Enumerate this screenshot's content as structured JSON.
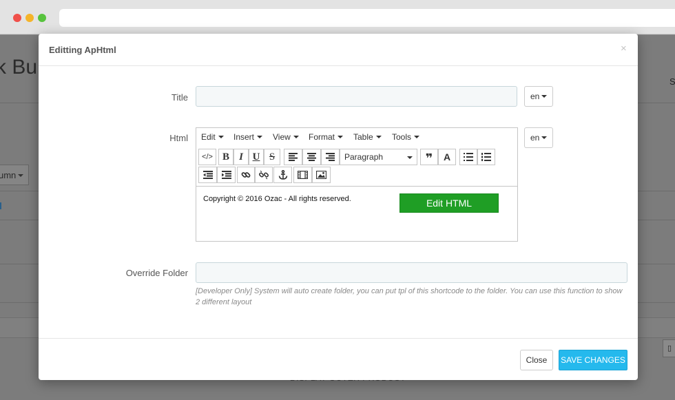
{
  "background_page": {
    "title_fragment": "k Bui",
    "column_button": "umn",
    "right_letter": "S",
    "bottom_text": "DISPLAY OUTER PRODUCT"
  },
  "modal": {
    "title": "Editting ApHtml",
    "close_glyph": "×",
    "form": {
      "title_label": "Title",
      "title_value": "",
      "title_lang": "en",
      "html_label": "Html",
      "html_lang": "en",
      "override_label": "Override Folder",
      "override_value": "",
      "help_text": "[Developer Only] System will auto create folder, you can put tpl of this shortcode to the folder. You can use this function to show 2 different layout"
    },
    "editor": {
      "menus": [
        "Edit",
        "Insert",
        "View",
        "Format",
        "Table",
        "Tools"
      ],
      "format_select": "Paragraph",
      "toolbar_buttons": {
        "source_code": "source-code-icon",
        "bold": "B",
        "italic": "I",
        "underline": "U",
        "strikethrough": "S",
        "align_left": "align-left-icon",
        "align_center": "align-center-icon",
        "align_right": "align-right-icon",
        "blockquote": "blockquote-icon",
        "text_color": "A",
        "bullet_list": "bullet-list-icon",
        "numbered_list": "numbered-list-icon",
        "outdent": "outdent-icon",
        "indent": "indent-icon",
        "link": "link-icon",
        "unlink": "unlink-icon",
        "anchor": "anchor-icon",
        "media": "film-icon",
        "image": "image-icon"
      },
      "content": "Copyright © 2016 Ozac - All rights reserved.",
      "edit_html_label": "Edit HTML"
    },
    "footer": {
      "close_label": "Close",
      "save_label": "SAVE CHANGES"
    }
  },
  "colors": {
    "save_button": "#25b9ed",
    "edit_html_button": "#1f9e25",
    "input_background": "#f5f8f9"
  }
}
